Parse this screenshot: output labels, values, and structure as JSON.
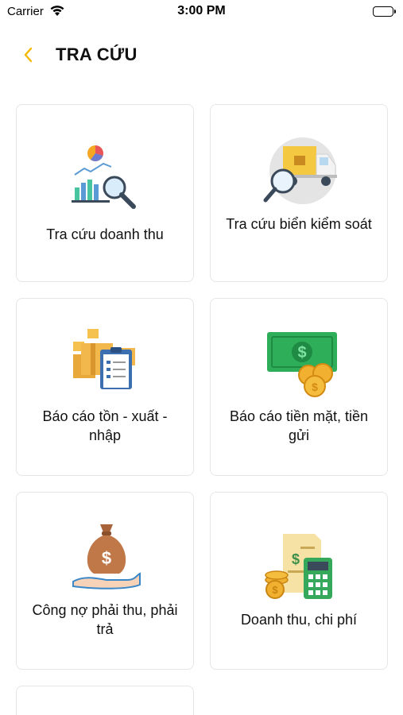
{
  "status_bar": {
    "carrier": "Carrier",
    "time": "3:00 PM"
  },
  "nav": {
    "back_icon": "chevron-left-icon",
    "title": "TRA CỨU"
  },
  "colors": {
    "accent": "#F5B800",
    "tile_border": "#E6E6E6"
  },
  "tiles": [
    {
      "label": "Tra cứu doanh thu",
      "icon": "revenue-chart-search-icon"
    },
    {
      "label": "Tra cứu biển kiểm soát",
      "icon": "truck-search-icon"
    },
    {
      "label": "Báo cáo tồn - xuất - nhập",
      "icon": "inventory-clipboard-icon"
    },
    {
      "label": "Báo cáo tiền mặt, tiền gửi",
      "icon": "cash-coins-icon"
    },
    {
      "label": "Công nợ phải thu, phải trả",
      "icon": "money-bag-hand-icon"
    },
    {
      "label": "Doanh thu, chi phí",
      "icon": "calculator-invoice-icon"
    }
  ]
}
